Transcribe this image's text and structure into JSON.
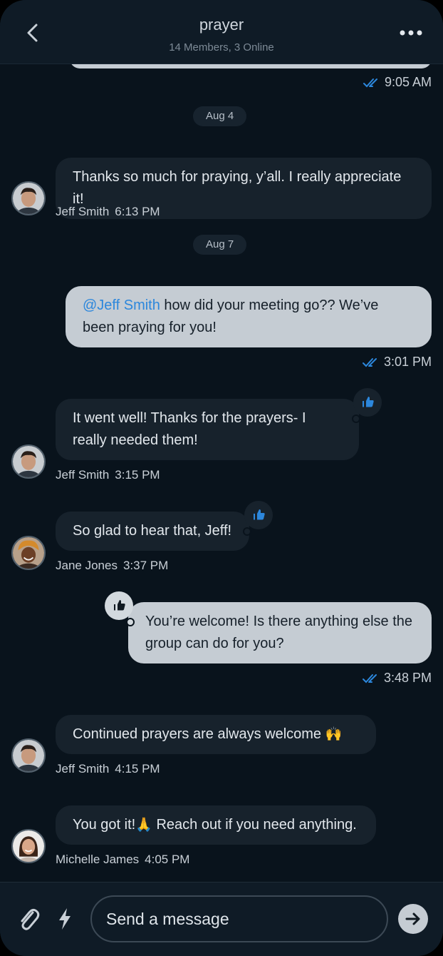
{
  "header": {
    "title": "prayer",
    "subtitle": "14 Members, 3 Online"
  },
  "messages": {
    "m0": {
      "time": "9:05 AM"
    },
    "d1": {
      "label": "Aug 4"
    },
    "m1": {
      "text": "Thanks so much for praying, y’all. I really appreciate it!",
      "author": "Jeff Smith",
      "time": "6:13 PM"
    },
    "d2": {
      "label": "Aug 7"
    },
    "m2": {
      "mention": "@Jeff Smith",
      "text_line1": " how did your meeting go?? We’ve",
      "text_line2": "been praying for you!",
      "time": "3:01 PM"
    },
    "m3": {
      "text_line1": "It went well! Thanks for the prayers- I",
      "text_line2": "really needed them!",
      "author": "Jeff Smith",
      "time": "3:15 PM",
      "reaction": "thumbs-up"
    },
    "m4": {
      "text": "So glad to hear that, Jeff!",
      "author": "Jane Jones",
      "time": "3:37 PM",
      "reaction": "thumbs-up"
    },
    "m5": {
      "text_line1": "You’re welcome! Is there anything else the",
      "text_line2": "group can do for you?",
      "time": "3:48 PM",
      "reaction": "thumbs-up"
    },
    "m6": {
      "text": "Continued prayers are always welcome",
      "emoji": "🙌",
      "author": "Jeff Smith",
      "time": "4:15 PM"
    },
    "m7": {
      "text_a": "You got it!",
      "emoji": "🙏",
      "text_b": " Reach out if you need anything.",
      "author": "Michelle James",
      "time": "4:05 PM"
    }
  },
  "composer": {
    "placeholder": "Send a message"
  },
  "icons": {
    "back": "chevron-left-icon",
    "more": "more-dots-icon",
    "read": "double-check-icon",
    "reaction": "thumbs-up-icon",
    "attach": "paperclip-icon",
    "commands": "lightning-icon",
    "send": "arrow-right-icon"
  },
  "colors": {
    "background": "#09131c",
    "header": "#0f1b26",
    "incoming_bubble": "#17222c",
    "outgoing_bubble": "#c5ccd3",
    "accent": "#2c87dc"
  }
}
